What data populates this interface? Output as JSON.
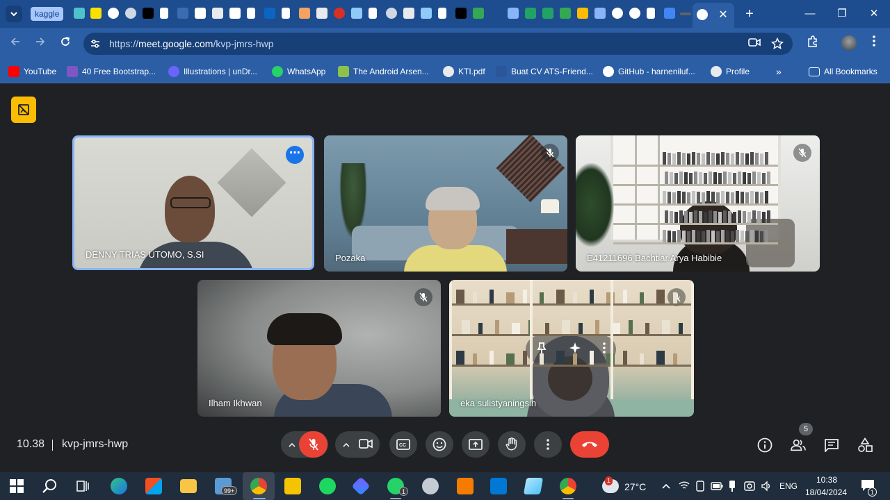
{
  "browser": {
    "tabs": {
      "kaggle_label": "kaggle",
      "close_symbol": "✕",
      "new_tab_symbol": "+",
      "win_minimize": "—",
      "win_restore": "❐",
      "win_close": "✕"
    },
    "url": {
      "scheme": "https://",
      "host": "meet.google.com",
      "path": "/kvp-jmrs-hwp"
    },
    "bookmarks": [
      {
        "label": "YouTube",
        "icon": "youtube-icon",
        "color": "#ff0000"
      },
      {
        "label": "40 Free Bootstrap...",
        "icon": "colorlib-icon",
        "color": "#7e57c2"
      },
      {
        "label": "Illustrations | unDr...",
        "icon": "undraw-icon",
        "color": "#6c63ff"
      },
      {
        "label": "WhatsApp",
        "icon": "whatsapp-icon",
        "color": "#25d366"
      },
      {
        "label": "The Android Arsen...",
        "icon": "android-icon",
        "color": "#8bc34a"
      },
      {
        "label": "KTI.pdf",
        "icon": "globe-icon",
        "color": "#e8eaed"
      },
      {
        "label": "Buat CV ATS-Friend...",
        "icon": "doc-icon",
        "color": "#2b579a"
      },
      {
        "label": "GitHub - harneniluf...",
        "icon": "github-icon",
        "color": "#ffffff"
      },
      {
        "label": "Profile",
        "icon": "globe-icon",
        "color": "#e8eaed"
      }
    ],
    "bookmarks_overflow": "»",
    "all_bookmarks": "All Bookmarks"
  },
  "meet": {
    "participants": [
      {
        "name": "DENNY TRIAS UTOMO, S.SI",
        "muted": false,
        "speaking": true
      },
      {
        "name": "Pozaka",
        "muted": true
      },
      {
        "name": "E41211696 Bachtiar Arya Habibie",
        "muted": true
      },
      {
        "name": "Ilham Ikhwan",
        "muted": true
      },
      {
        "name": "eka sulistyaningsih",
        "muted": true
      }
    ],
    "time": "10.38",
    "meeting_code": "kvp-jmrs-hwp",
    "participant_count": "5"
  },
  "taskbar": {
    "mail_badge": "99+",
    "whatsapp_badge": "1",
    "weather_badge": "1",
    "temperature": "27°C",
    "language": "ENG",
    "clock_time": "10:38",
    "clock_date": "18/04/2024",
    "notif_count": "1"
  },
  "colors": {
    "tab_strip": "#1d4d8f",
    "toolbar": "#2c5ea5",
    "meet_bg": "#202124",
    "end_call": "#ea4335",
    "speaking_border": "#8ab4f8",
    "badge_yellow": "#fbbc04"
  }
}
